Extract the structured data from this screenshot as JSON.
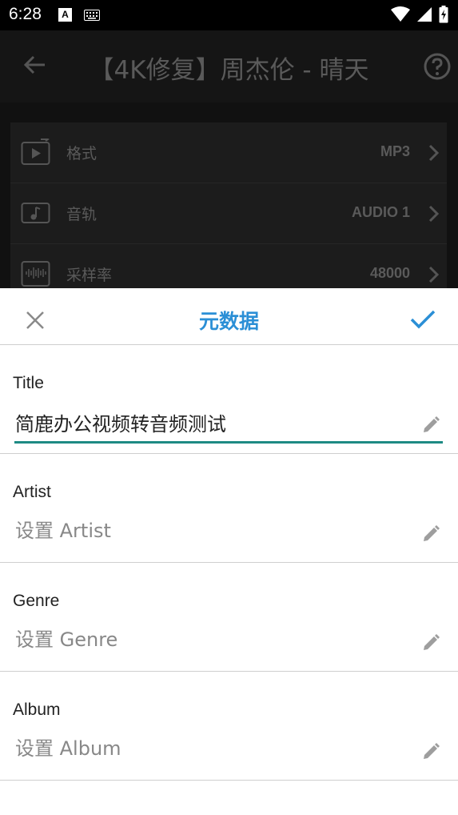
{
  "status_bar": {
    "time": "6:28",
    "a_badge": "A"
  },
  "background": {
    "title": "【4K修复】周杰伦 - 晴天",
    "rows": [
      {
        "label": "格式",
        "value": "MP3",
        "icon": "format-play-icon"
      },
      {
        "label": "音轨",
        "value": "AUDIO 1",
        "icon": "music-note-icon"
      },
      {
        "label": "采样率",
        "value": "48000",
        "icon": "hz-waveform-icon"
      }
    ]
  },
  "sheet": {
    "title": "元数据",
    "fields": [
      {
        "label": "Title",
        "value": "简鹿办公视频转音频测试",
        "placeholder": ""
      },
      {
        "label": "Artist",
        "value": "",
        "placeholder": "设置 Artist"
      },
      {
        "label": "Genre",
        "value": "",
        "placeholder": "设置 Genre"
      },
      {
        "label": "Album",
        "value": "",
        "placeholder": "设置 Album"
      }
    ]
  },
  "colors": {
    "accent": "#2b8fd6",
    "focus_underline": "#1e8a84",
    "divider": "#cfcfcf"
  }
}
